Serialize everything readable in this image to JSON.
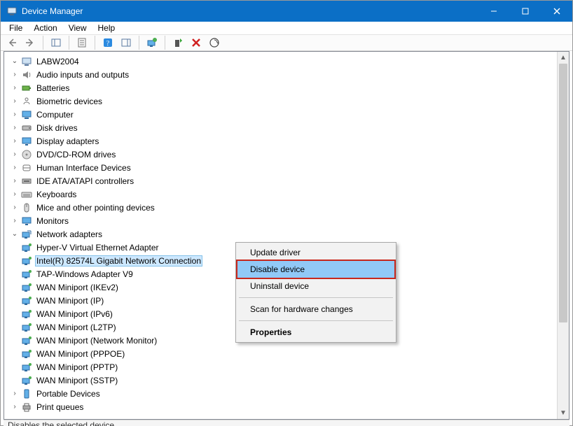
{
  "window": {
    "title": "Device Manager"
  },
  "menubar": {
    "items": [
      "File",
      "Action",
      "View",
      "Help"
    ]
  },
  "toolbar": {
    "buttons": [
      {
        "name": "back-icon"
      },
      {
        "name": "forward-icon"
      },
      {
        "name": "show-hide-tree-icon"
      },
      {
        "name": "properties-sheet-icon"
      },
      {
        "name": "help-icon"
      },
      {
        "name": "action-pane-icon"
      },
      {
        "name": "update-driver-icon"
      },
      {
        "name": "enable-device-icon"
      },
      {
        "name": "uninstall-device-icon"
      },
      {
        "name": "scan-hardware-icon"
      }
    ]
  },
  "tree": {
    "root": {
      "label": "LABW2004"
    },
    "categories": [
      {
        "label": "Audio inputs and outputs",
        "icon": "audio"
      },
      {
        "label": "Batteries",
        "icon": "battery"
      },
      {
        "label": "Biometric devices",
        "icon": "biometric"
      },
      {
        "label": "Computer",
        "icon": "computer"
      },
      {
        "label": "Disk drives",
        "icon": "disk"
      },
      {
        "label": "Display adapters",
        "icon": "display"
      },
      {
        "label": "DVD/CD-ROM drives",
        "icon": "cdrom"
      },
      {
        "label": "Human Interface Devices",
        "icon": "hid"
      },
      {
        "label": "IDE ATA/ATAPI controllers",
        "icon": "ide"
      },
      {
        "label": "Keyboards",
        "icon": "keyboard"
      },
      {
        "label": "Mice and other pointing devices",
        "icon": "mouse"
      },
      {
        "label": "Monitors",
        "icon": "monitor"
      },
      {
        "label": "Network adapters",
        "icon": "network",
        "expanded": true,
        "children": [
          {
            "label": "Hyper-V Virtual Ethernet Adapter"
          },
          {
            "label": "Intel(R) 82574L Gigabit Network Connection",
            "selected": true
          },
          {
            "label": "TAP-Windows Adapter V9"
          },
          {
            "label": "WAN Miniport (IKEv2)"
          },
          {
            "label": "WAN Miniport (IP)"
          },
          {
            "label": "WAN Miniport (IPv6)"
          },
          {
            "label": "WAN Miniport (L2TP)"
          },
          {
            "label": "WAN Miniport (Network Monitor)"
          },
          {
            "label": "WAN Miniport (PPPOE)"
          },
          {
            "label": "WAN Miniport (PPTP)"
          },
          {
            "label": "WAN Miniport (SSTP)"
          }
        ]
      },
      {
        "label": "Portable Devices",
        "icon": "portable"
      },
      {
        "label": "Print queues",
        "icon": "printer"
      }
    ]
  },
  "context_menu": {
    "items": [
      {
        "label": "Update driver"
      },
      {
        "label": "Disable device",
        "highlighted": true
      },
      {
        "label": "Uninstall device"
      },
      {
        "sep": true
      },
      {
        "label": "Scan for hardware changes"
      },
      {
        "sep": true
      },
      {
        "label": "Properties",
        "bold": true
      }
    ]
  },
  "statusbar": {
    "text": "Disables the selected device."
  }
}
